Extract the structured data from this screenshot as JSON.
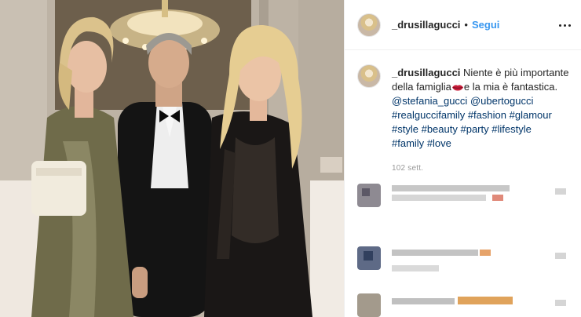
{
  "post": {
    "username": "_drusillagucci",
    "separator": "•",
    "follow_label": "Segui",
    "more_icon": "more-options-icon"
  },
  "caption": {
    "username": "_drusillagucci",
    "text_1": "Niente è più importante della famiglia",
    "emoji": "lips-icon",
    "text_2": "e la mia è fantastica.",
    "mentions": [
      "@stefania_gucci",
      "@ubertogucci"
    ],
    "hashtags": [
      "#realguccifamily",
      "#fashion",
      "#glamour",
      "#style",
      "#beauty",
      "#party",
      "#lifestyle",
      "#family",
      "#love"
    ],
    "time_ago": "102 sett."
  },
  "colors": {
    "link_blue": "#3897f0",
    "tag_blue": "#003569",
    "muted": "#999999",
    "text": "#262626"
  }
}
